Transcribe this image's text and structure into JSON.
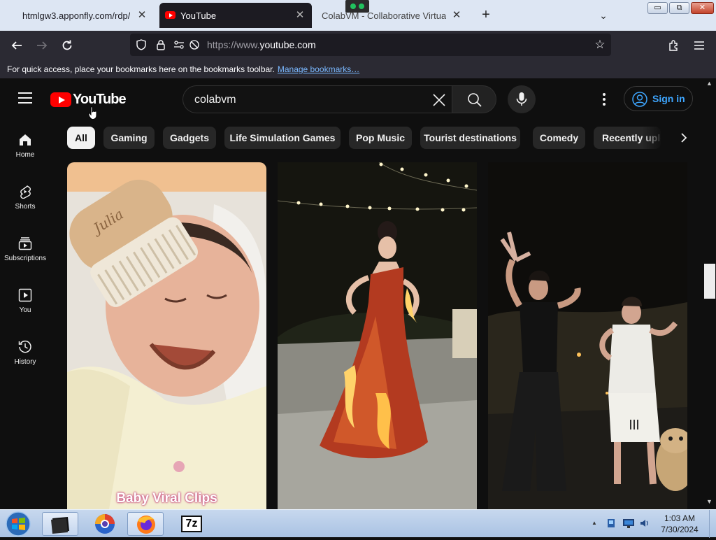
{
  "browser": {
    "tabs": [
      {
        "title": "htmlgw3.apponfly.com/rdp/",
        "active": false
      },
      {
        "title": "YouTube",
        "active": true
      },
      {
        "title": "ColabVM - Collaborative Virtual Machines",
        "active": false
      }
    ],
    "new_tab_label": "+",
    "tab_list_label": "⌄",
    "window_controls": {
      "minimize": "▭",
      "maximize": "⧉",
      "close": "✕"
    },
    "url_prefix": "https://www.",
    "url_domain": "youtube.com",
    "bookmarks_message": "For quick access, place your bookmarks here on the bookmarks toolbar.",
    "bookmarks_link": "Manage bookmarks…"
  },
  "youtube": {
    "logo_text": "YouTube",
    "search_value": "colabvm",
    "signin_label": "Sign in",
    "guide": [
      {
        "label": "Home",
        "icon": "home-icon"
      },
      {
        "label": "Shorts",
        "icon": "shorts-icon"
      },
      {
        "label": "Subscriptions",
        "icon": "subscriptions-icon"
      },
      {
        "label": "You",
        "icon": "you-icon"
      },
      {
        "label": "History",
        "icon": "history-icon"
      }
    ],
    "chips": [
      "All",
      "Gaming",
      "Gadgets",
      "Life Simulation Games",
      "Pop Music",
      "Tourist destinations",
      "Comedy",
      "Recently uploaded"
    ],
    "active_chip": "All",
    "shorts": [
      {
        "caption": "Baby Viral Clips",
        "subject": "smiling baby with wooden hair brush"
      },
      {
        "caption": "",
        "subject": "woman in flaming red dress at night"
      },
      {
        "caption": "",
        "subject": "two men dancing at night"
      }
    ]
  },
  "taskbar": {
    "apps": [
      "terminal",
      "browser",
      "firefox",
      "7-zip"
    ],
    "app_7zip_label": "7z",
    "tray_up": "▲",
    "time": "1:03 AM",
    "date": "7/30/2024"
  },
  "colors": {
    "yt_bg": "#0f0f0f",
    "yt_red": "#ff0000",
    "link_blue": "#3ea6ff",
    "chip_bg": "#272727",
    "firefox_toolbar": "#2b2a33"
  }
}
